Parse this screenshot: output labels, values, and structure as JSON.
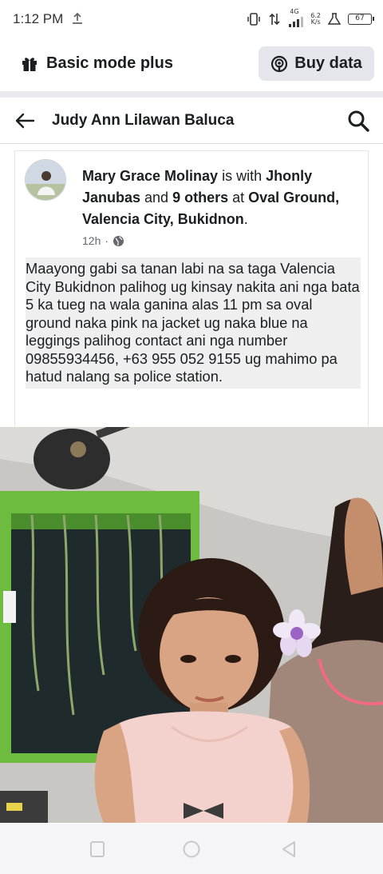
{
  "status": {
    "time": "1:12 PM",
    "network_type": "4G",
    "speed_value": "6.2",
    "speed_unit": "K/s",
    "battery": "67"
  },
  "app_header": {
    "mode_label": "Basic mode plus",
    "buy_label": "Buy data"
  },
  "profile_bar": {
    "title": "Judy Ann Lilawan Baluca"
  },
  "post": {
    "author": "Mary Grace Molinay",
    "with_word": " is with ",
    "tagged": "Jhonly Janubas",
    "and_word": " and ",
    "others": "9 others",
    "at_word": " at ",
    "location": "Oval Ground, Valencia City, Bukidnon",
    "period": ".",
    "time": "12h",
    "separator": "·",
    "body": "Maayong gabi sa tanan labi na sa taga Valencia City Bukidnon palihog ug kinsay nakita ani nga bata 5 ka tueg na wala ganina alas 11 pm sa oval ground naka pink na jacket ug naka blue na leggings palihog contact ani nga number 09855934456, +63 955 052 9155 ug mahimo pa hatud nalang sa police station."
  },
  "icons": {
    "upload": "upload-icon",
    "gift": "gift-icon",
    "buy": "podcast-icon",
    "back": "back-arrow-icon",
    "search": "search-icon",
    "privacy": "globe-icon"
  },
  "colors": {
    "text": "#1c1e21",
    "meta": "#65676b",
    "button_bg": "#e4e6eb",
    "text_highlight": "#efeff0"
  }
}
